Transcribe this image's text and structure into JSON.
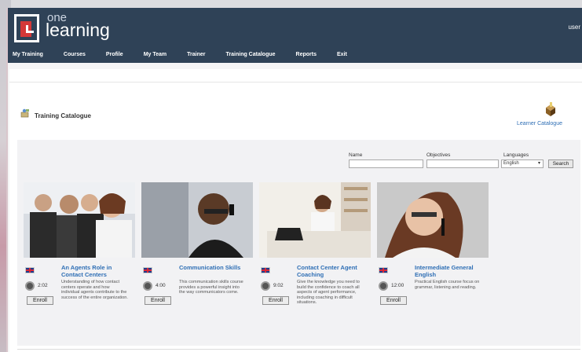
{
  "header": {
    "logo_one": "one",
    "logo_learning": "learning",
    "user_label": "user"
  },
  "nav": [
    {
      "label": "My Training"
    },
    {
      "label": "Courses"
    },
    {
      "label": "Profile"
    },
    {
      "label": "My Team"
    },
    {
      "label": "Trainer"
    },
    {
      "label": "Training Catalogue"
    },
    {
      "label": "Reports"
    },
    {
      "label": "Exit"
    }
  ],
  "page": {
    "title": "Training Catalogue",
    "learner_catalogue_link": "Learner Catalogue"
  },
  "filters": {
    "name_label": "Name",
    "objectives_label": "Objectives",
    "language_label": "Languages",
    "language_value": "English",
    "search_button": "Search"
  },
  "courses": [
    {
      "title": "An Agents Role in Contact Centers",
      "duration": "2:02",
      "enroll": "Enroll",
      "description": "Understanding of how contact centers operate and how individual agents contribute to the success of the entire organization."
    },
    {
      "title": "Communication Skills",
      "duration": "4:00",
      "enroll": "Enroll",
      "description": "This communication skills course provides a powerful insight into the way communicators come."
    },
    {
      "title": "Contact Center Agent Coaching",
      "duration": "9:02",
      "enroll": "Enroll",
      "description": "Give the knowledge you need to build the confidence to coach all aspects of agent performance, including coaching in difficult situations."
    },
    {
      "title": "Intermediate General English",
      "duration": "12:00",
      "enroll": "Enroll",
      "description": "Practical English course focus on grammar, listening and reading."
    }
  ],
  "colors": {
    "header_bg": "#2f4257",
    "link_blue": "#2f6fb5",
    "logo_red": "#d43838"
  }
}
